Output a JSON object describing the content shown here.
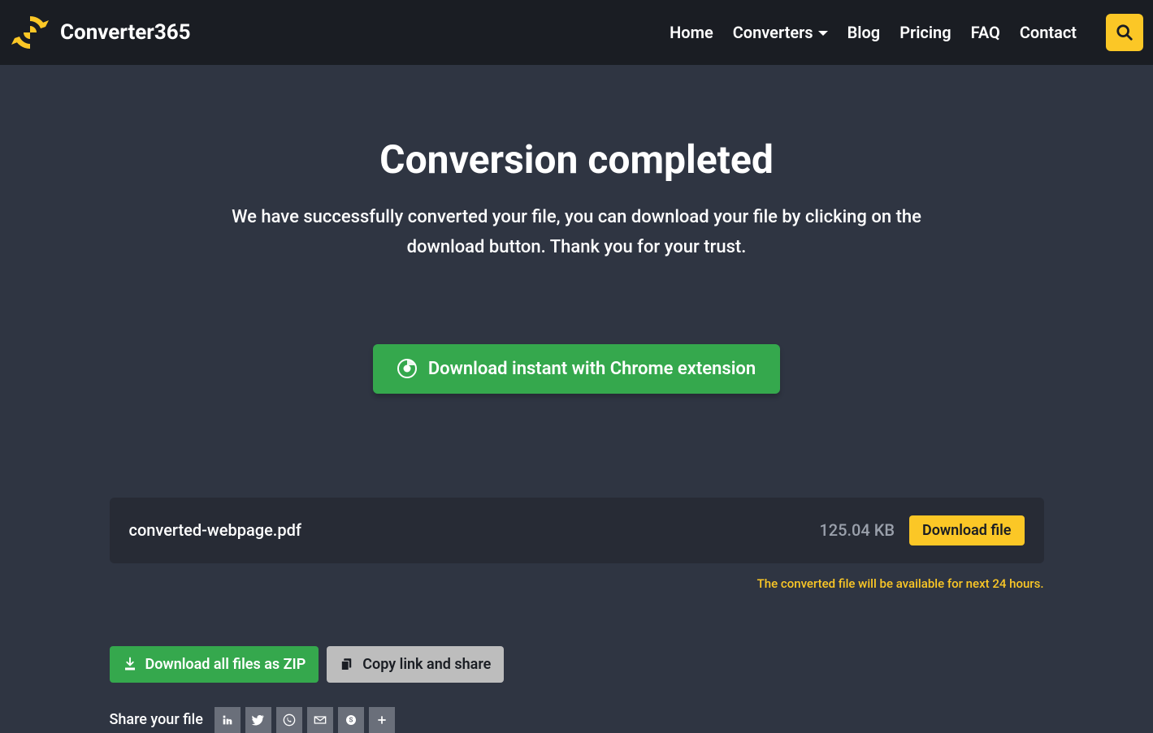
{
  "header": {
    "brand": "Converter365",
    "nav": {
      "home": "Home",
      "converters": "Converters",
      "blog": "Blog",
      "pricing": "Pricing",
      "faq": "FAQ",
      "contact": "Contact"
    }
  },
  "main": {
    "title": "Conversion completed",
    "subtitle": "We have successfully converted your file, you can download your file by clicking on the download button. Thank you for your trust.",
    "chrome_button": "Download instant with Chrome extension"
  },
  "file": {
    "name": "converted-webpage.pdf",
    "size": "125.04 KB",
    "download_label": "Download file",
    "availability": "The converted file will be available for next 24 hours."
  },
  "actions": {
    "zip": "Download all files as ZIP",
    "copy": "Copy link and share"
  },
  "share": {
    "label": "Share your file"
  }
}
